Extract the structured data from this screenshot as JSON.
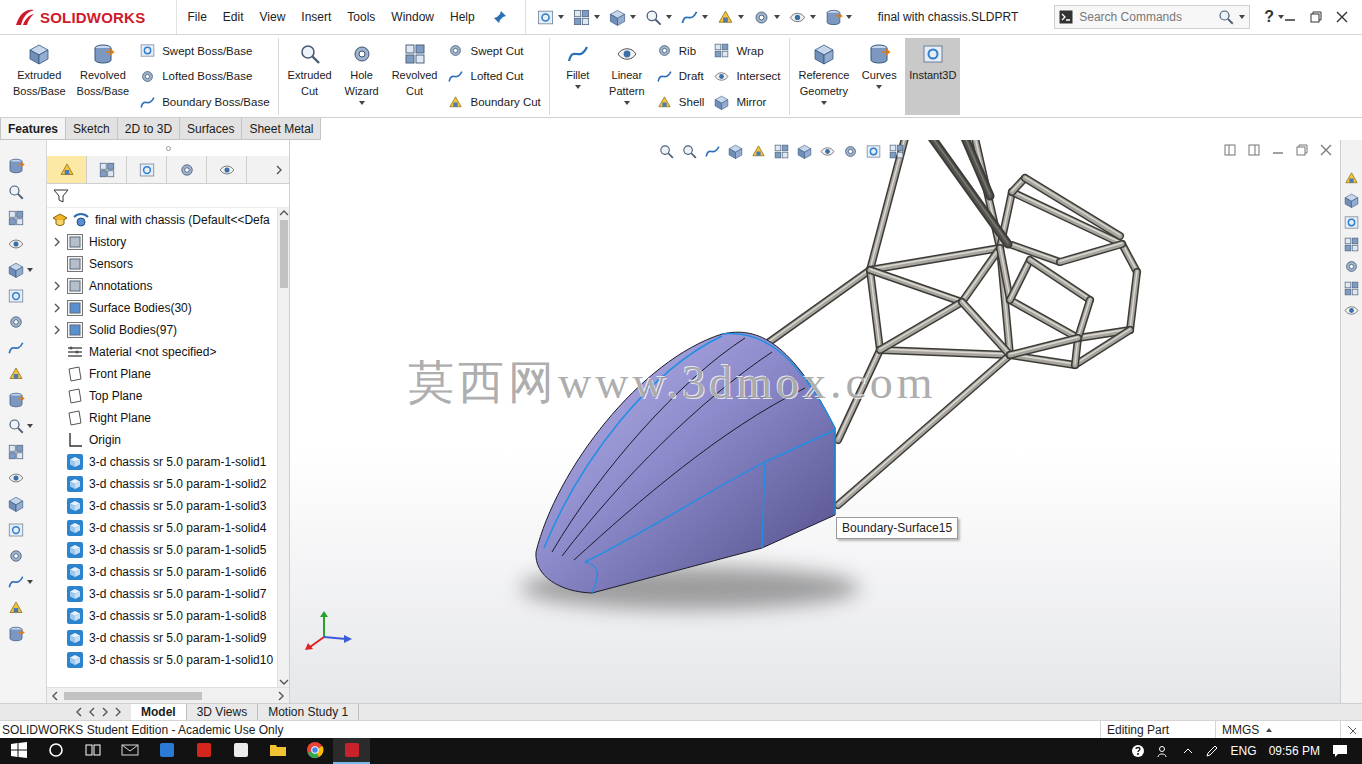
{
  "app": {
    "logo": "SOLIDWORKS",
    "title": "final with chassis.SLDPRT",
    "help_glyph": "?"
  },
  "menu": [
    "File",
    "Edit",
    "View",
    "Insert",
    "Tools",
    "Window",
    "Help"
  ],
  "search": {
    "placeholder": "Search Commands"
  },
  "ribbon": [
    {
      "items": [
        {
          "kind": "large",
          "lines": [
            "Extruded",
            "Boss/Base"
          ],
          "dropdown": false,
          "active": false
        },
        {
          "kind": "large",
          "lines": [
            "Revolved",
            "Boss/Base"
          ],
          "dropdown": false,
          "active": false
        },
        {
          "kind": "stack",
          "labels": [
            "Swept Boss/Base",
            "Lofted Boss/Base",
            "Boundary Boss/Base"
          ]
        }
      ]
    },
    {
      "items": [
        {
          "kind": "large",
          "lines": [
            "Extruded",
            "Cut"
          ],
          "dropdown": false,
          "active": false
        },
        {
          "kind": "large",
          "lines": [
            "Hole",
            "Wizard"
          ],
          "dropdown": true,
          "active": false
        },
        {
          "kind": "large",
          "lines": [
            "Revolved",
            "Cut"
          ],
          "dropdown": false,
          "active": false
        },
        {
          "kind": "stack",
          "labels": [
            "Swept Cut",
            "Lofted Cut",
            "Boundary Cut"
          ]
        }
      ]
    },
    {
      "items": [
        {
          "kind": "large",
          "lines": [
            "Fillet"
          ],
          "dropdown": true,
          "active": false
        },
        {
          "kind": "large",
          "lines": [
            "Linear",
            "Pattern"
          ],
          "dropdown": true,
          "active": false
        },
        {
          "kind": "stack",
          "labels": [
            "Rib",
            "Draft",
            "Shell"
          ]
        },
        {
          "kind": "stack",
          "labels": [
            "Wrap",
            "Intersect",
            "Mirror"
          ]
        }
      ]
    },
    {
      "items": [
        {
          "kind": "large",
          "lines": [
            "Reference",
            "Geometry"
          ],
          "dropdown": true,
          "active": false
        },
        {
          "kind": "large",
          "lines": [
            "Curves"
          ],
          "dropdown": true,
          "active": false
        },
        {
          "kind": "large",
          "lines": [
            "Instant3D"
          ],
          "dropdown": false,
          "active": true
        }
      ]
    }
  ],
  "command_tabs": [
    {
      "label": "Features",
      "selected": true
    },
    {
      "label": "Sketch",
      "selected": false
    },
    {
      "label": "2D to 3D",
      "selected": false
    },
    {
      "label": "Surfaces",
      "selected": false
    },
    {
      "label": "Sheet Metal",
      "selected": false
    }
  ],
  "feature_tree": [
    {
      "label": "final with chassis (Default<<Defa",
      "kind": "root",
      "expandable": false
    },
    {
      "label": "History",
      "kind": "history",
      "expandable": true
    },
    {
      "label": "Sensors",
      "kind": "sensor",
      "expandable": false
    },
    {
      "label": "Annotations",
      "kind": "annotation",
      "expandable": true
    },
    {
      "label": "Surface Bodies(30)",
      "kind": "folder",
      "expandable": true
    },
    {
      "label": "Solid Bodies(97)",
      "kind": "folder",
      "expandable": true
    },
    {
      "label": "Material <not specified>",
      "kind": "material",
      "expandable": false
    },
    {
      "label": "Front Plane",
      "kind": "plane",
      "expandable": false
    },
    {
      "label": "Top Plane",
      "kind": "plane",
      "expandable": false
    },
    {
      "label": "Right Plane",
      "kind": "plane",
      "expandable": false
    },
    {
      "label": "Origin",
      "kind": "origin",
      "expandable": false
    },
    {
      "label": "3-d chassis sr 5.0 param-1-solid1",
      "kind": "body",
      "expandable": false
    },
    {
      "label": "3-d chassis sr 5.0 param-1-solid2",
      "kind": "body",
      "expandable": false
    },
    {
      "label": "3-d chassis sr 5.0 param-1-solid3",
      "kind": "body",
      "expandable": false
    },
    {
      "label": "3-d chassis sr 5.0 param-1-solid4",
      "kind": "body",
      "expandable": false
    },
    {
      "label": "3-d chassis sr 5.0 param-1-solid5",
      "kind": "body",
      "expandable": false
    },
    {
      "label": "3-d chassis sr 5.0 param-1-solid6",
      "kind": "body",
      "expandable": false
    },
    {
      "label": "3-d chassis sr 5.0 param-1-solid7",
      "kind": "body",
      "expandable": false
    },
    {
      "label": "3-d chassis sr 5.0 param-1-solid8",
      "kind": "body",
      "expandable": false
    },
    {
      "label": "3-d chassis sr 5.0 param-1-solid9",
      "kind": "body",
      "expandable": false
    },
    {
      "label": "3-d chassis sr 5.0 param-1-solid10",
      "kind": "body",
      "expandable": false
    }
  ],
  "graphics": {
    "tooltip": "Boundary-Surface15",
    "watermark": "莫西网www.3dmox.com"
  },
  "bottom_tabs": [
    {
      "label": "Model",
      "selected": true
    },
    {
      "label": "3D Views",
      "selected": false
    },
    {
      "label": "Motion Study 1",
      "selected": false
    }
  ],
  "status_bar": {
    "message": "SOLIDWORKS Student Edition - Academic Use Only",
    "mode": "Editing Part",
    "units": "MMGS"
  },
  "taskbar": {
    "language": "ENG",
    "time": "09:56 PM"
  }
}
